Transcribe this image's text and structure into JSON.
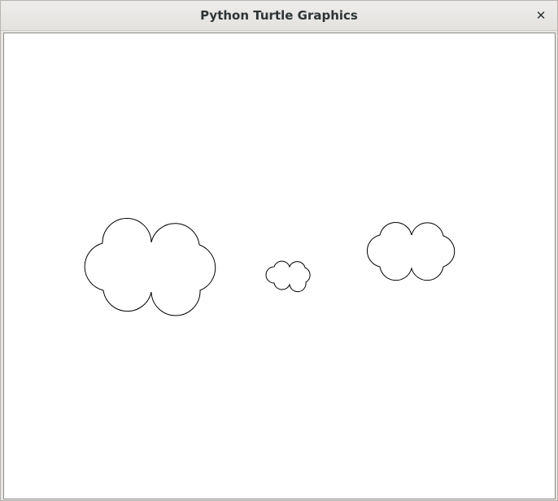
{
  "window": {
    "title": "Python Turtle Graphics",
    "close_glyph": "✕"
  },
  "canvas": {
    "background": "#ffffff",
    "stroke_color": "#000000",
    "shapes": [
      {
        "name": "cloud-large",
        "type": "cloud"
      },
      {
        "name": "cloud-small",
        "type": "cloud"
      },
      {
        "name": "cloud-medium",
        "type": "cloud"
      }
    ]
  },
  "icons": {
    "close": "close-icon"
  }
}
